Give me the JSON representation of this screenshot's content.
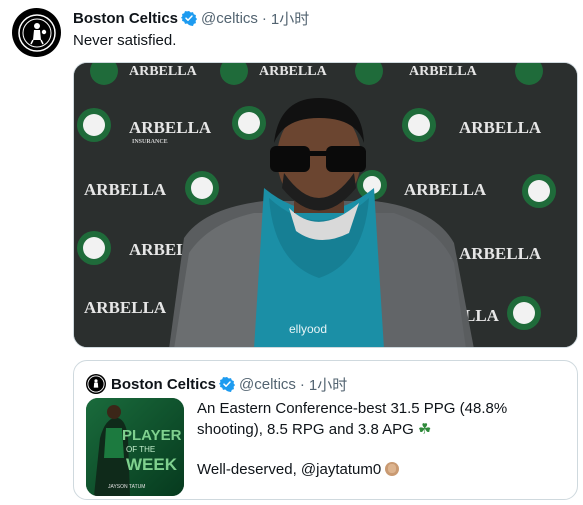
{
  "tweet": {
    "author_name": "Boston Celtics",
    "handle": "@celtics",
    "separator": "·",
    "time": "1小时",
    "text": "Never satisfied.",
    "media": {
      "backdrop_brand_text": "ARBELLA",
      "backdrop_brand_subtext": "INSURANCE",
      "shirt_text": "ellyood"
    }
  },
  "quote": {
    "author_name": "Boston Celtics",
    "handle": "@celtics",
    "separator": "·",
    "time": "1小时",
    "text_line1": "An Eastern Conference-best 31.5 PPG (48.8% shooting), 8.5 RPG and 3.8 APG",
    "clover": "☘",
    "text_line2": "Well-deserved, @jaytatum0",
    "thumb": {
      "title_top": "PLAYER",
      "title_of": "OF THE",
      "title_bottom": "WEEK",
      "caption": "JAYSON TATUM"
    }
  },
  "colors": {
    "verified": "#1d9bf0",
    "celtics_green": "#007a33",
    "backdrop": "#2a2e2d",
    "hoodie": "#1b8fa6",
    "secondary_text": "#536471",
    "border": "#cfd9de"
  },
  "icons": [
    "celtics-logo-icon",
    "verified-badge-icon",
    "shamrock-emoji",
    "clapping-hands-emoji"
  ]
}
